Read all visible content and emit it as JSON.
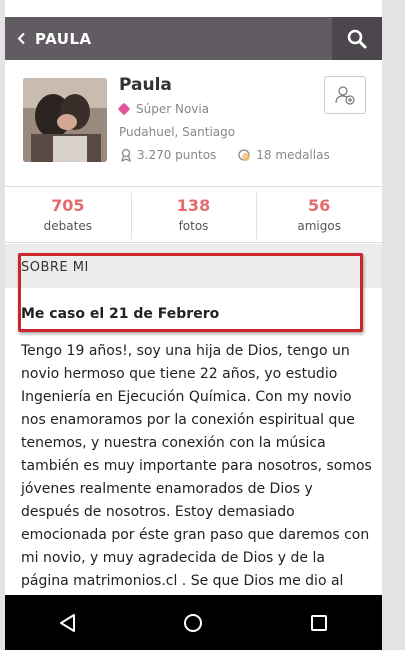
{
  "appbar": {
    "back_label": "PAULA"
  },
  "profile": {
    "name": "Paula",
    "rank": "Súper Novia",
    "location": "Pudahuel, Santiago",
    "points": "3.270 puntos",
    "medals": "18 medallas"
  },
  "counts": [
    {
      "value": "705",
      "label": "debates"
    },
    {
      "value": "138",
      "label": "fotos"
    },
    {
      "value": "56",
      "label": "amigos"
    }
  ],
  "about": {
    "title": "SOBRE MI",
    "subtitle": "Me caso el 21 de Febrero",
    "bio": "Tengo 19 años!, soy una hija de Dios, tengo un novio hermoso que tiene 22 años, yo estudio Ingeniería en Ejecución Química. Con my novio nos enamoramos por la conexión espiritual que tenemos, y nuestra conexión con la música también es muy importante para nosotros, somos jóvenes realmente enamorados de Dios y después de nosotros. Estoy demasiado emocionada por éste gran paso que daremos con mi novio, y muy agradecida de Dios y de la página matrimonios.cl . Se que Dios me dio al mejor hombre del planeta"
  },
  "icons": {
    "back": "chevron-left-icon",
    "search": "search-icon",
    "add_friend": "add-friend-icon",
    "points": "trophy-icon",
    "medals": "medal-icon",
    "nav_back": "triangle-back-icon",
    "nav_home": "circle-home-icon",
    "nav_recent": "square-recent-icon"
  },
  "colors": {
    "appbar": "#615c61",
    "search_button": "#4c474c",
    "count_accent": "#e46c6e",
    "rank_badge": "#e0559a",
    "annotation": "#c9262c"
  }
}
